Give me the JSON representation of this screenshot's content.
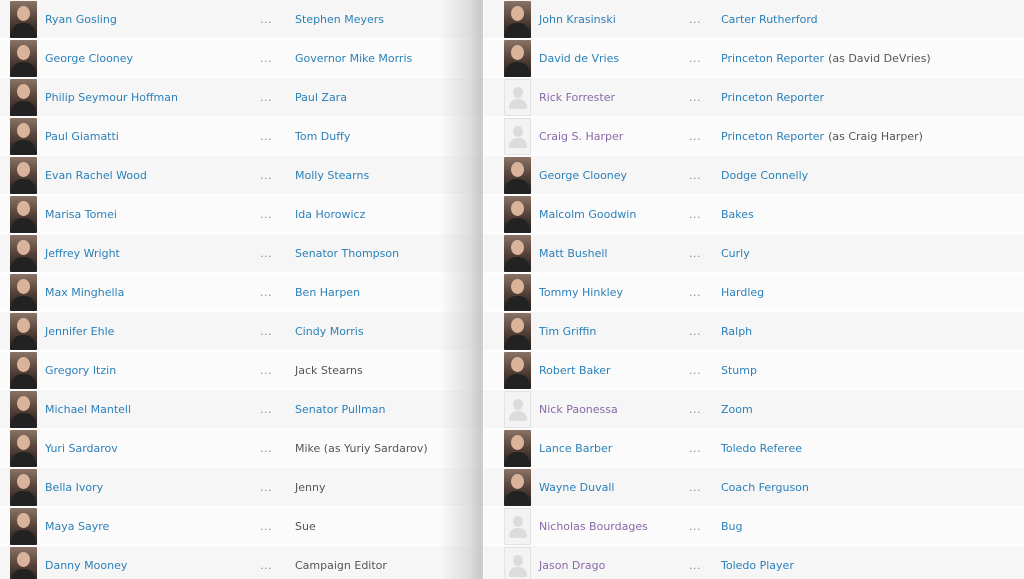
{
  "cast_left": [
    {
      "actor": "Ryan Gosling",
      "character": "Stephen Meyers",
      "character_linked": true,
      "note": "",
      "photo": true,
      "visited": false
    },
    {
      "actor": "George Clooney",
      "character": "Governor Mike Morris",
      "character_linked": true,
      "note": "",
      "photo": true,
      "visited": false
    },
    {
      "actor": "Philip Seymour Hoffman",
      "character": "Paul Zara",
      "character_linked": true,
      "note": "",
      "photo": true,
      "visited": false
    },
    {
      "actor": "Paul Giamatti",
      "character": "Tom Duffy",
      "character_linked": true,
      "note": "",
      "photo": true,
      "visited": false
    },
    {
      "actor": "Evan Rachel Wood",
      "character": "Molly Stearns",
      "character_linked": true,
      "note": "",
      "photo": true,
      "visited": false
    },
    {
      "actor": "Marisa Tomei",
      "character": "Ida Horowicz",
      "character_linked": true,
      "note": "",
      "photo": true,
      "visited": false
    },
    {
      "actor": "Jeffrey Wright",
      "character": "Senator Thompson",
      "character_linked": true,
      "note": "",
      "photo": true,
      "visited": false
    },
    {
      "actor": "Max Minghella",
      "character": "Ben Harpen",
      "character_linked": true,
      "note": "",
      "photo": true,
      "visited": false
    },
    {
      "actor": "Jennifer Ehle",
      "character": "Cindy Morris",
      "character_linked": true,
      "note": "",
      "photo": true,
      "visited": false
    },
    {
      "actor": "Gregory Itzin",
      "character": "Jack Stearns",
      "character_linked": false,
      "note": "",
      "photo": true,
      "visited": false
    },
    {
      "actor": "Michael Mantell",
      "character": "Senator Pullman",
      "character_linked": true,
      "note": "",
      "photo": true,
      "visited": false
    },
    {
      "actor": "Yuri Sardarov",
      "character": "Mike (as Yuriy Sardarov)",
      "character_linked": false,
      "note": "",
      "photo": true,
      "visited": false
    },
    {
      "actor": "Bella Ivory",
      "character": "Jenny",
      "character_linked": false,
      "note": "",
      "photo": true,
      "visited": false
    },
    {
      "actor": "Maya Sayre",
      "character": "Sue",
      "character_linked": false,
      "note": "",
      "photo": true,
      "visited": false
    },
    {
      "actor": "Danny Mooney",
      "character": "Campaign Editor",
      "character_linked": false,
      "note": "",
      "photo": true,
      "visited": false
    }
  ],
  "cast_right": [
    {
      "actor": "John Krasinski",
      "character": "Carter Rutherford",
      "character_linked": true,
      "note": "",
      "photo": true,
      "visited": false
    },
    {
      "actor": "David de Vries",
      "character": "Princeton Reporter",
      "character_linked": true,
      "note": "(as David DeVries)",
      "photo": true,
      "visited": false
    },
    {
      "actor": "Rick Forrester",
      "character": "Princeton Reporter",
      "character_linked": true,
      "note": "",
      "photo": false,
      "visited": true
    },
    {
      "actor": "Craig S. Harper",
      "character": "Princeton Reporter",
      "character_linked": true,
      "note": "(as Craig Harper)",
      "photo": false,
      "visited": true
    },
    {
      "actor": "George Clooney",
      "character": "Dodge Connelly",
      "character_linked": true,
      "note": "",
      "photo": true,
      "visited": false
    },
    {
      "actor": "Malcolm Goodwin",
      "character": "Bakes",
      "character_linked": true,
      "note": "",
      "photo": true,
      "visited": false
    },
    {
      "actor": "Matt Bushell",
      "character": "Curly",
      "character_linked": true,
      "note": "",
      "photo": true,
      "visited": false
    },
    {
      "actor": "Tommy Hinkley",
      "character": "Hardleg",
      "character_linked": true,
      "note": "",
      "photo": true,
      "visited": false
    },
    {
      "actor": "Tim Griffin",
      "character": "Ralph",
      "character_linked": true,
      "note": "",
      "photo": true,
      "visited": false
    },
    {
      "actor": "Robert Baker",
      "character": "Stump",
      "character_linked": true,
      "note": "",
      "photo": true,
      "visited": false
    },
    {
      "actor": "Nick Paonessa",
      "character": "Zoom",
      "character_linked": true,
      "note": "",
      "photo": false,
      "visited": true
    },
    {
      "actor": "Lance Barber",
      "character": "Toledo Referee",
      "character_linked": true,
      "note": "",
      "photo": true,
      "visited": false
    },
    {
      "actor": "Wayne Duvall",
      "character": "Coach Ferguson",
      "character_linked": true,
      "note": "",
      "photo": true,
      "visited": false
    },
    {
      "actor": "Nicholas Bourdages",
      "character": "Bug",
      "character_linked": true,
      "note": "",
      "photo": false,
      "visited": true
    },
    {
      "actor": "Jason Drago",
      "character": "Toledo Player",
      "character_linked": true,
      "note": "",
      "photo": false,
      "visited": true
    }
  ],
  "separator": "...",
  "colors": {
    "link": "#2a80b9",
    "visited_link": "#8a68a8",
    "plain_text": "#555555",
    "row_odd": "#f6f6f6",
    "row_even": "#fbfbfb"
  }
}
